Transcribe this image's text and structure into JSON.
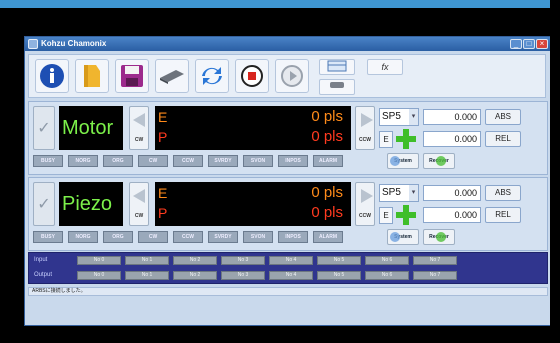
{
  "window": {
    "title": "Kohzu Chamonix"
  },
  "toolbar": {
    "icons": [
      "info-icon",
      "folder-icon",
      "save-icon",
      "send-icon",
      "refresh-icon",
      "stop-icon",
      "play-icon"
    ],
    "fx_label": "fx"
  },
  "axes": [
    {
      "name": "Motor",
      "e_label": "E",
      "e_value": "0 pls",
      "p_label": "P",
      "p_value": "0 pls",
      "ccw_left": "CW",
      "ccw_right": "CCW",
      "speed": "SP5",
      "e_btn": "E",
      "abs_value": "0.000",
      "abs_label": "ABS",
      "rel_value": "0.000",
      "rel_label": "REL",
      "status": [
        "BUSY",
        "NORG",
        "ORG",
        "CW",
        "CCW",
        "SVRDY",
        "SVON",
        "INPOS",
        "ALARM"
      ],
      "system_label": "System",
      "recover_label": "Recover"
    },
    {
      "name": "Piezo",
      "e_label": "E",
      "e_value": "0 pls",
      "p_label": "P",
      "p_value": "0 pls",
      "ccw_left": "CW",
      "ccw_right": "CCW",
      "speed": "SP5",
      "e_btn": "E",
      "abs_value": "0.000",
      "abs_label": "ABS",
      "rel_value": "0.000",
      "rel_label": "REL",
      "status": [
        "BUSY",
        "NORG",
        "ORG",
        "CW",
        "CCW",
        "SVRDY",
        "SVON",
        "INPOS",
        "ALARM"
      ],
      "system_label": "System",
      "recover_label": "Recover"
    }
  ],
  "io": {
    "input_label": "Input",
    "output_label": "Output",
    "inputs": [
      "No 0",
      "No 1",
      "No 2",
      "No 3",
      "No 4",
      "No 5",
      "No 6",
      "No 7"
    ],
    "outputs": [
      "No 0",
      "No 1",
      "No 2",
      "No 3",
      "No 4",
      "No 5",
      "No 6",
      "No 7"
    ]
  },
  "statusbar": {
    "text": "ARBSに接続しました。"
  },
  "colors": {
    "accent": "#2a5ea3",
    "e_value": "#ff8a1a",
    "p_value": "#ff3b1f",
    "name_text": "#7cf04a"
  }
}
